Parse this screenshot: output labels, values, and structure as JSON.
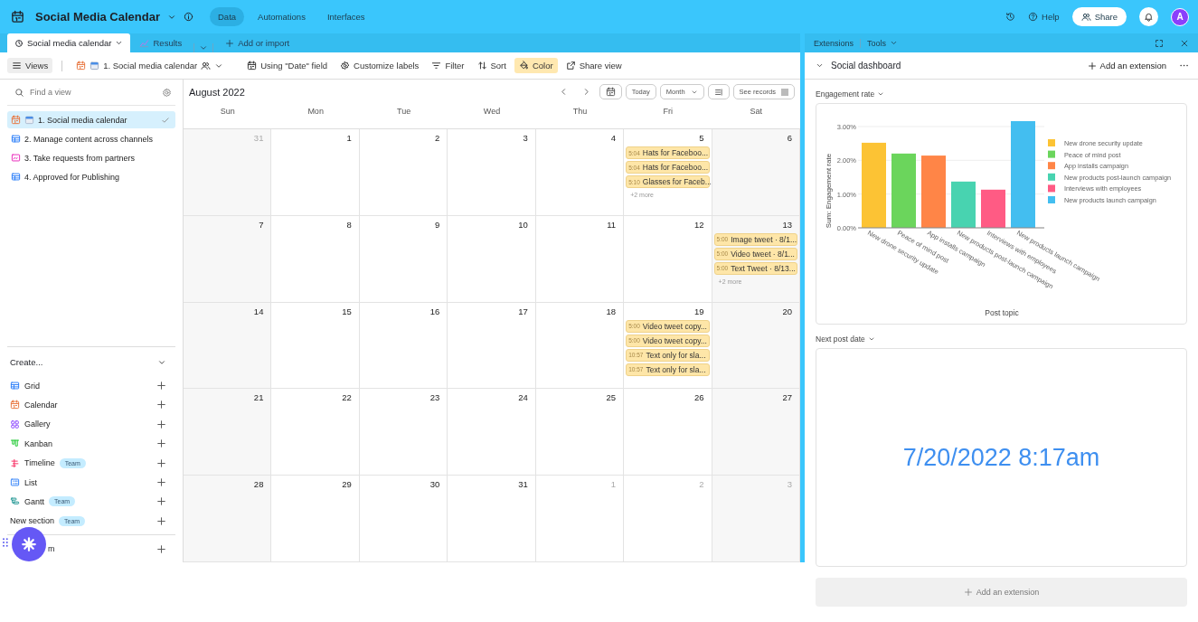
{
  "top_bar": {
    "title": "Social Media Calendar",
    "nav": [
      {
        "label": "Data",
        "selected": true
      },
      {
        "label": "Automations",
        "selected": false
      },
      {
        "label": "Interfaces",
        "selected": false
      }
    ],
    "help": "Help",
    "share": "Share",
    "avatar": "A"
  },
  "table_tabs": {
    "tabs": [
      {
        "label": "Social media calendar",
        "selected": true
      },
      {
        "label": "Results",
        "selected": false
      }
    ],
    "add": "Add or import"
  },
  "toolbar": {
    "views": "Views",
    "view_name": "1. Social media calendar",
    "actions": [
      {
        "kind": "date-field",
        "label": "Using \"Date\" field",
        "active": false
      },
      {
        "kind": "labels",
        "label": "Customize labels",
        "active": false
      },
      {
        "kind": "filter",
        "label": "Filter",
        "active": false
      },
      {
        "kind": "sort",
        "label": "Sort",
        "active": false
      },
      {
        "kind": "color",
        "label": "Color",
        "active": true
      },
      {
        "kind": "share",
        "label": "Share view",
        "active": false
      }
    ]
  },
  "sidebar": {
    "search_placeholder": "Find a view",
    "views": [
      {
        "label": "1. Social media calendar",
        "kind": "calendar",
        "emoji_icon": true,
        "selected": true
      },
      {
        "label": "2. Manage content across channels",
        "kind": "grid",
        "emoji_icon": false,
        "selected": false
      },
      {
        "label": "3. Take requests from partners",
        "kind": "form",
        "emoji_icon": false,
        "selected": false
      },
      {
        "label": "4. Approved for Publishing",
        "kind": "grid",
        "emoji_icon": false,
        "selected": false
      }
    ],
    "create_title": "Create...",
    "create_items": [
      {
        "kind": "grid",
        "label": "Grid"
      },
      {
        "kind": "calendar",
        "label": "Calendar"
      },
      {
        "kind": "gallery",
        "label": "Gallery"
      },
      {
        "kind": "kanban",
        "label": "Kanban"
      },
      {
        "kind": "timeline",
        "label": "Timeline",
        "badge": "Team"
      },
      {
        "kind": "list",
        "label": "List"
      },
      {
        "kind": "gantt",
        "label": "Gantt",
        "badge": "Team"
      },
      {
        "kind": "section",
        "label": "New section",
        "badge": "Team"
      },
      {
        "kind": "covered",
        "label": "m"
      }
    ]
  },
  "calendar": {
    "month": "August 2022",
    "today": "Today",
    "mode": "Month",
    "see_records": "See records",
    "weekdays": [
      "Sun",
      "Mon",
      "Tue",
      "Wed",
      "Thu",
      "Fri",
      "Sat"
    ],
    "weeks": [
      [
        {
          "day": "31",
          "in_month": false
        },
        {
          "day": "1",
          "in_month": true
        },
        {
          "day": "2",
          "in_month": true
        },
        {
          "day": "3",
          "in_month": true
        },
        {
          "day": "4",
          "in_month": true
        },
        {
          "day": "5",
          "in_month": true,
          "events": [
            {
              "time": "5:04",
              "title": "Hats for Faceboo..."
            },
            {
              "time": "5:04",
              "title": "Hats for Faceboo..."
            },
            {
              "time": "5:10",
              "title": "Glasses for Faceb..."
            }
          ],
          "more": "+2 more"
        },
        {
          "day": "6",
          "in_month": true
        }
      ],
      [
        {
          "day": "7",
          "in_month": true
        },
        {
          "day": "8",
          "in_month": true
        },
        {
          "day": "9",
          "in_month": true
        },
        {
          "day": "10",
          "in_month": true
        },
        {
          "day": "11",
          "in_month": true
        },
        {
          "day": "12",
          "in_month": true
        },
        {
          "day": "13",
          "in_month": true,
          "events": [
            {
              "time": "5:00",
              "title": "Image tweet · 8/1..."
            },
            {
              "time": "5:00",
              "title": "Video tweet · 8/1..."
            },
            {
              "time": "5:00",
              "title": "Text Tweet · 8/13..."
            }
          ],
          "more": "+2 more"
        }
      ],
      [
        {
          "day": "14",
          "in_month": true
        },
        {
          "day": "15",
          "in_month": true
        },
        {
          "day": "16",
          "in_month": true
        },
        {
          "day": "17",
          "in_month": true
        },
        {
          "day": "18",
          "in_month": true
        },
        {
          "day": "19",
          "in_month": true,
          "events": [
            {
              "time": "5:00",
              "title": "Video tweet copy..."
            },
            {
              "time": "5:00",
              "title": "Video tweet copy..."
            },
            {
              "time": "10:57",
              "title": "Text only for sla..."
            },
            {
              "time": "10:57",
              "title": "Text only for sla..."
            }
          ]
        },
        {
          "day": "20",
          "in_month": true
        }
      ],
      [
        {
          "day": "21",
          "in_month": true
        },
        {
          "day": "22",
          "in_month": true
        },
        {
          "day": "23",
          "in_month": true
        },
        {
          "day": "24",
          "in_month": true
        },
        {
          "day": "25",
          "in_month": true
        },
        {
          "day": "26",
          "in_month": true
        },
        {
          "day": "27",
          "in_month": true
        }
      ],
      [
        {
          "day": "28",
          "in_month": true
        },
        {
          "day": "29",
          "in_month": true
        },
        {
          "day": "30",
          "in_month": true
        },
        {
          "day": "31",
          "in_month": true
        },
        {
          "day": "1",
          "in_month": false
        },
        {
          "day": "2",
          "in_month": false
        },
        {
          "day": "3",
          "in_month": false
        }
      ]
    ]
  },
  "extensions": {
    "title": "Extensions",
    "tools": "Tools",
    "dashboard": "Social dashboard",
    "add_extension": "Add an extension",
    "engagement": {
      "title": "Engagement rate",
      "chart_data": {
        "type": "bar",
        "xlabel": "Post topic",
        "ylabel": "Sum: Engagement rate",
        "categories": [
          "New drone security update",
          "Peace of mind post",
          "App installs campaign",
          "New products post-launch campaign",
          "Interviews with employees",
          "New products launch campaign"
        ],
        "values": [
          2.52,
          2.2,
          2.14,
          1.37,
          1.13,
          3.16
        ],
        "ylim": [
          0,
          3.2
        ],
        "grid": true,
        "yticks": [
          {
            "value": 0,
            "label": "0.00%"
          },
          {
            "value": 1,
            "label": "1.00%"
          },
          {
            "value": 2,
            "label": "2.00%"
          },
          {
            "value": 3,
            "label": "3.00%"
          }
        ]
      },
      "legend": [
        {
          "label": "New drone security update",
          "color": "#fcc334"
        },
        {
          "label": "Peace of mind post",
          "color": "#6bd55c"
        },
        {
          "label": "App installs campaign",
          "color": "#ff8547"
        },
        {
          "label": "New products post-launch campaign",
          "color": "#48d3b0"
        },
        {
          "label": "Interviews with employees",
          "color": "#ff5b84"
        },
        {
          "label": "New products launch campaign",
          "color": "#43bef0"
        }
      ]
    },
    "next_post": {
      "title": "Next post date",
      "value": "7/20/2022 8:17am"
    },
    "footer_button": "Add an extension"
  }
}
